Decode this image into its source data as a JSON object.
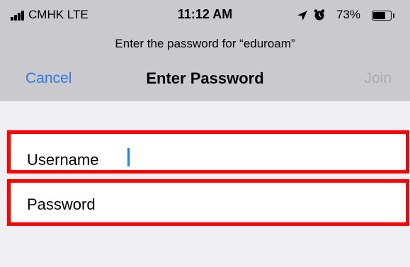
{
  "status_bar": {
    "carrier": "CMHK  LTE",
    "time": "11:12 AM",
    "battery": "73%",
    "battery_level": 0.73,
    "icons": [
      "signal-icon",
      "location-arrow-icon",
      "alarm-icon",
      "battery-icon"
    ]
  },
  "header": {
    "prompt": "Enter the password for “eduroam”",
    "cancel_label": "Cancel",
    "title": "Enter Password",
    "join_label": "Join"
  },
  "form": {
    "username_label": "Username",
    "username_value": "",
    "password_label": "Password",
    "password_value": ""
  },
  "colors": {
    "accent": "#2a7ce6",
    "disabled": "#acacb1",
    "highlight_border": "#ff0000",
    "header_bg": "#c9c9ce",
    "page_bg": "#efeff4"
  }
}
